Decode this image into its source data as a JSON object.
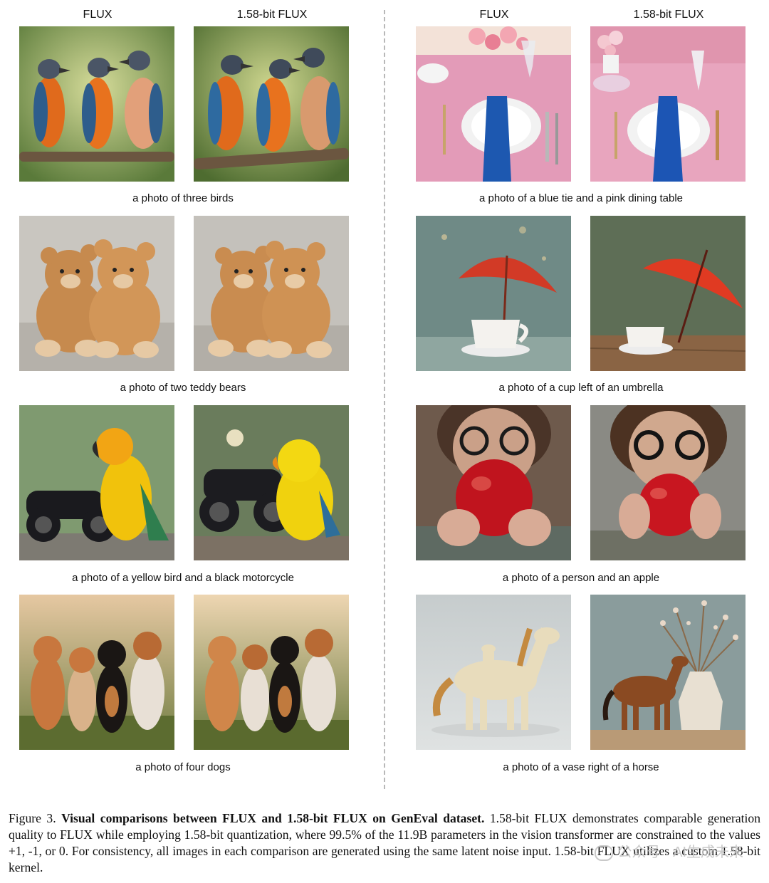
{
  "column_headers": {
    "left_a": "FLUX",
    "left_b": "1.58-bit FLUX",
    "right_a": "FLUX",
    "right_b": "1.58-bit FLUX"
  },
  "captions": {
    "birds": "a photo of three birds",
    "tie": "a photo of a blue tie and a pink dining table",
    "bears": "a photo of two teddy bears",
    "cup": "a photo of a cup left of an umbrella",
    "parrot": "a photo of a yellow bird and a black motorcycle",
    "apple": "a photo of a person and an apple",
    "dogs": "a photo of four dogs",
    "horse": "a photo of a vase right of a horse"
  },
  "figure_caption": {
    "label": "Figure 3.",
    "bold": "Visual comparisons between FLUX and 1.58-bit FLUX on GenEval dataset.",
    "body": "1.58-bit FLUX demonstrates comparable generation quality to FLUX while employing 1.58-bit quantization, where 99.5% of the 11.9B parameters in the vision transformer are constrained to the values +1, -1, or 0. For consistency, all images in each comparison are generated using the same latent noise input. 1.58-bit FLUX utilizes a custom 1.58-bit kernel."
  },
  "watermark": "公众号 · AI生成未来",
  "colors": {
    "divider": "#b8b8b8",
    "text": "#111111"
  }
}
